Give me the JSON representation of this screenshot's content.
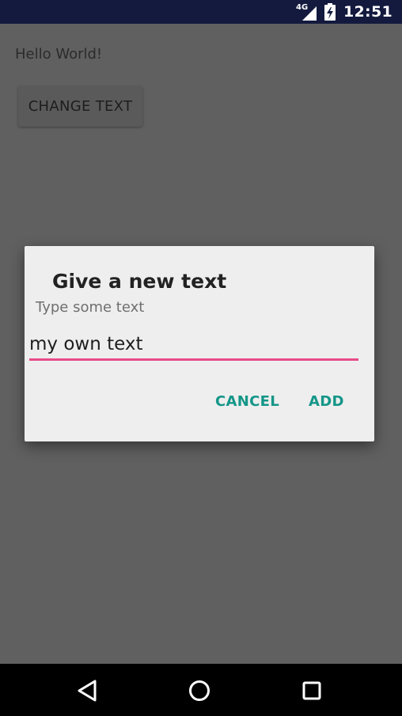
{
  "status_bar": {
    "network": "4G",
    "time": "12:51",
    "icons": [
      "signal-icon",
      "battery-charging-icon"
    ],
    "background": "#131A3E"
  },
  "main": {
    "hello_text": "Hello World!",
    "change_button_label": "CHANGE TEXT"
  },
  "dialog": {
    "title": "Give a new text",
    "message": "Type some text",
    "input_value": "my own text",
    "cancel_label": "CANCEL",
    "add_label": "ADD",
    "accent_color": "#139688",
    "input_underline_color": "#E74B87"
  },
  "nav_bar": {
    "icons": [
      "back-icon",
      "home-icon",
      "recents-icon"
    ]
  }
}
